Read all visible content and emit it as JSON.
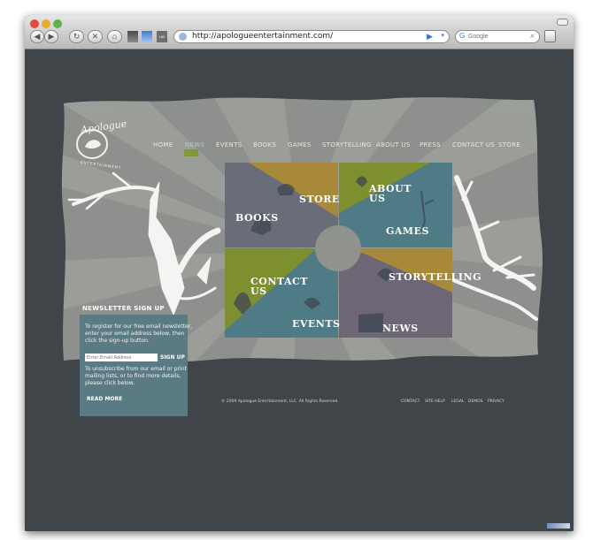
{
  "browser": {
    "url": "http://apologueentertainment.com/",
    "search_placeholder": "Google"
  },
  "site": {
    "logo_name": "Apologue",
    "logo_sub": "ENTERTAINMENT"
  },
  "nav": [
    "HOME",
    "NEWS",
    "EVENTS",
    "BOOKS",
    "GAMES",
    "STORYTELLING",
    "ABOUT US",
    "PRESS",
    "CONTACT US",
    "STORE"
  ],
  "grid": {
    "books": "BOOKS",
    "store": "STORE",
    "about_line1": "ABOUT",
    "about_line2": "US",
    "games": "GAMES",
    "contact_line1": "CONTACT",
    "contact_line2": "US",
    "events": "EVENTS",
    "storytelling": "STORYTELLING",
    "news": "NEWS"
  },
  "newsletter": {
    "title": "NEWSLETTER SIGN UP",
    "intro_1": "To register for our free email newsletter,",
    "intro_2": "enter your email address below, then",
    "intro_3": "click the sign-up button.",
    "email_placeholder": "Enter Email Address",
    "signup": "SIGN UP",
    "unsub_1": "To unsubscribe from our email or print",
    "unsub_2": "mailing lists, or to find more details,",
    "unsub_3": "please click below.",
    "read_more": "READ MORE"
  },
  "footer": {
    "copyright": "© 2009 Apologue Entertainment, LLC. All Rights Reserved.",
    "links": [
      "CONTACT",
      "SITE HELP",
      "LEGAL",
      "DEMOS",
      "PRIVACY"
    ]
  },
  "colors": {
    "background": "#3f4548",
    "panel": "#8c8f8b",
    "slate": "#686d77",
    "gold": "#a8893a",
    "olive": "#7e8f2f",
    "teal": "#4f7b86",
    "purple": "#6c6675"
  }
}
